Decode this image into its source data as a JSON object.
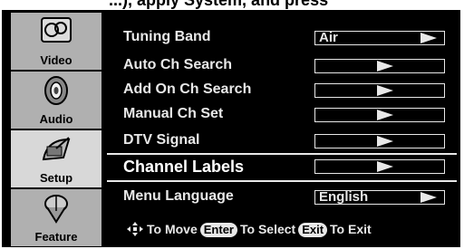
{
  "top_text": "...), apply System, and press",
  "sidebar": {
    "items": [
      {
        "label": "Video",
        "icon": "video-icon"
      },
      {
        "label": "Audio",
        "icon": "speaker-icon"
      },
      {
        "label": "Setup",
        "icon": "satellite-dish-icon",
        "active": true
      },
      {
        "label": "Feature",
        "icon": "feature-icon"
      }
    ]
  },
  "menu": {
    "rows": [
      {
        "label": "Tuning Band",
        "value": "Air"
      },
      {
        "label": "Auto Ch Search",
        "value": ""
      },
      {
        "label": "Add On Ch Search",
        "value": ""
      },
      {
        "label": "Manual Ch Set",
        "value": ""
      },
      {
        "label": "DTV Signal",
        "value": ""
      },
      {
        "label": "Channel Labels",
        "value": "",
        "selected": true
      },
      {
        "label": "Menu Language",
        "value": "English"
      }
    ]
  },
  "help": {
    "move": "To Move",
    "enter_key": "Enter",
    "select": "To Select",
    "exit_key": "Exit",
    "exit": "To Exit"
  },
  "colors": {
    "background": "#000000",
    "text": "#e8e8e8",
    "sidebar": "#b0b0b0"
  }
}
